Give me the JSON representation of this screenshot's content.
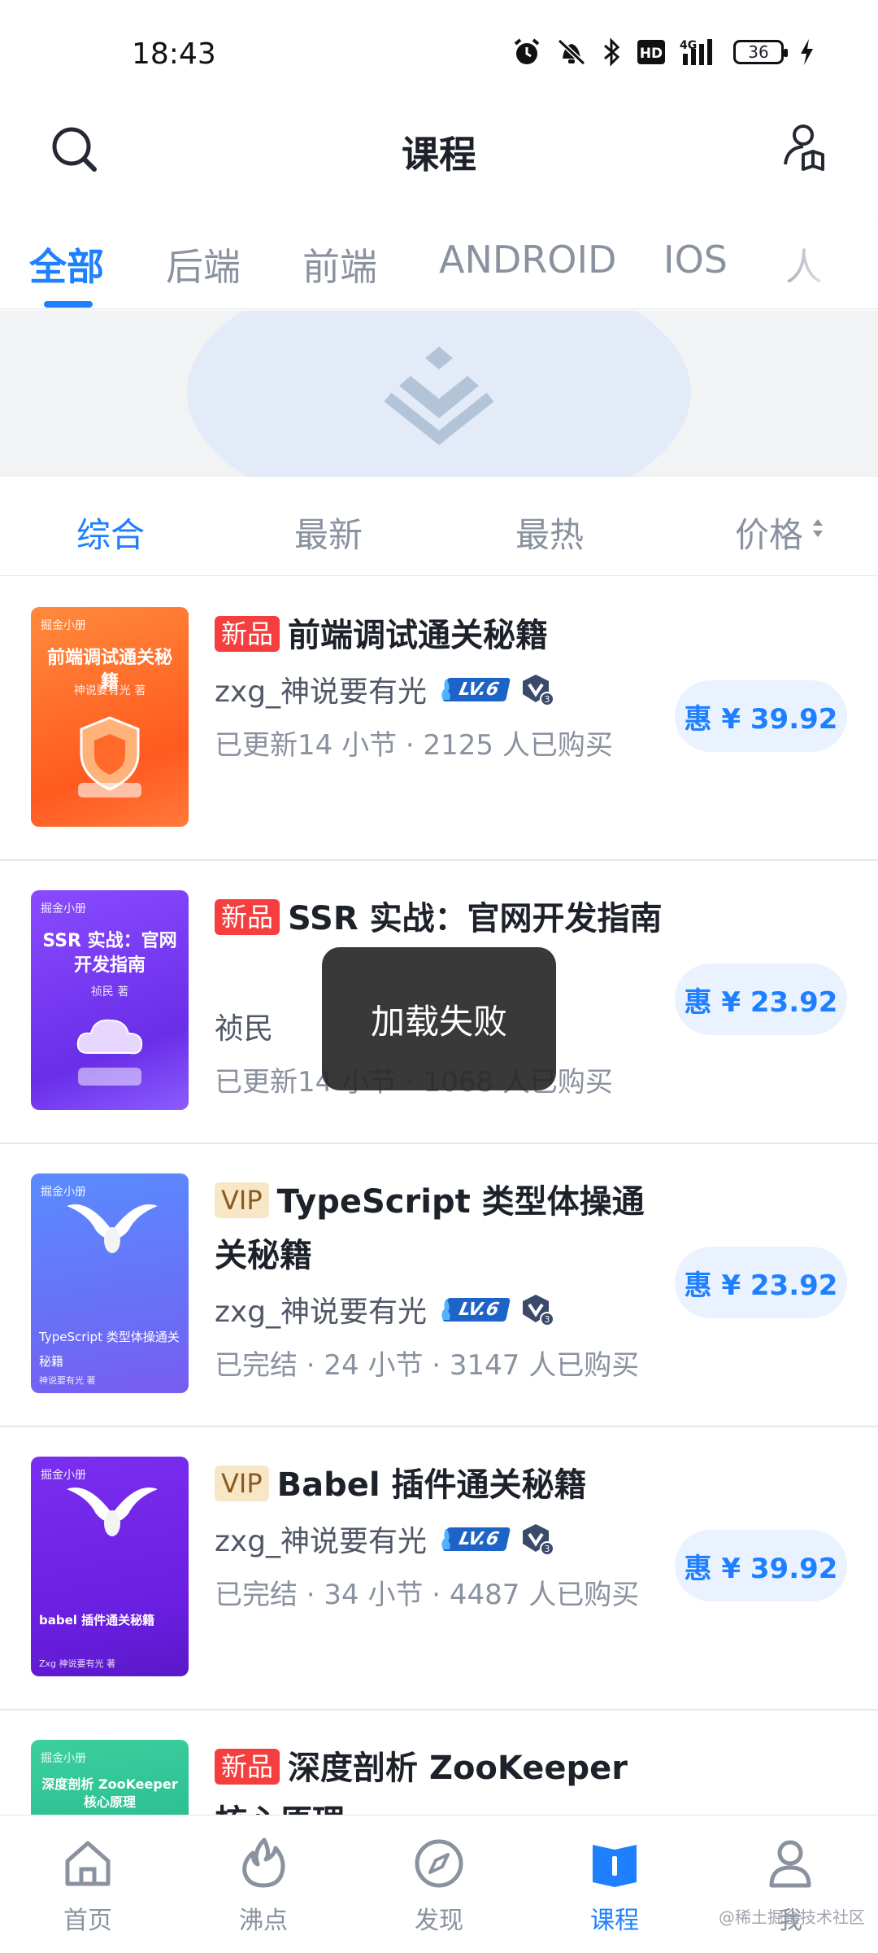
{
  "status_bar": {
    "time": "18:43",
    "battery": "36"
  },
  "header": {
    "title": "课程"
  },
  "category_tabs": [
    "全部",
    "后端",
    "前端",
    "ANDROID",
    "IOS",
    "人"
  ],
  "sort_tabs": [
    "综合",
    "最新",
    "最热",
    "价格"
  ],
  "courses": [
    {
      "tag": "新品",
      "title": "前端调试通关秘籍",
      "author": "zxg_神说要有光",
      "level": "LV.6",
      "v_level": "3",
      "meta": "已更新14 小节 · 2125 人已购买",
      "price": "惠 ¥ 39.92",
      "cover_brand": "掘金小册",
      "cover_title": "前端调试通关秘籍",
      "cover_sub": "神说要有光 著"
    },
    {
      "tag": "新品",
      "title": "SSR 实战：官网开发指南",
      "author": "祯民",
      "meta": "已更新14 小节 · 1068 人已购买",
      "price": "惠 ¥ 23.92",
      "cover_brand": "掘金小册",
      "cover_title": "SSR 实战：官网开发指南",
      "cover_sub": "祯民 著"
    },
    {
      "tag": "VIP",
      "title": "TypeScript 类型体操通关秘籍",
      "author": "zxg_神说要有光",
      "level": "LV.6",
      "v_level": "3",
      "meta": "已完结 · 24 小节 · 3147 人已购买",
      "price": "惠 ¥ 23.92",
      "cover_brand": "掘金小册",
      "cover_title": "TypeScript 类型体操通关秘籍",
      "cover_sub": "神说要有光 著"
    },
    {
      "tag": "VIP",
      "title": "Babel 插件通关秘籍",
      "author": "zxg_神说要有光",
      "level": "LV.6",
      "v_level": "3",
      "meta": "已完结 · 34 小节 · 4487 人已购买",
      "price": "惠 ¥ 39.92",
      "cover_brand": "掘金小册",
      "cover_title": "babel 插件通关秘籍",
      "cover_sub": "Zxg 神说要有光 著"
    },
    {
      "tag": "新品",
      "title": "深度剖析 ZooKeeper 核心原理",
      "cover_brand": "掘金小册",
      "cover_title": "深度剖析 ZooKeeper 核心原理"
    }
  ],
  "toast": "加载失败",
  "bottom_nav": [
    "首页",
    "沸点",
    "发现",
    "课程",
    "我"
  ],
  "watermark": "@稀土掘金技术社区",
  "colors": {
    "accent": "#1e80ff",
    "new_tag": "#f53f3f",
    "vip_tag": "#f7e7c6"
  },
  "icons": [
    "search-icon",
    "profile-book-icon",
    "home-icon",
    "flame-icon",
    "compass-icon",
    "book-icon",
    "user-icon"
  ]
}
